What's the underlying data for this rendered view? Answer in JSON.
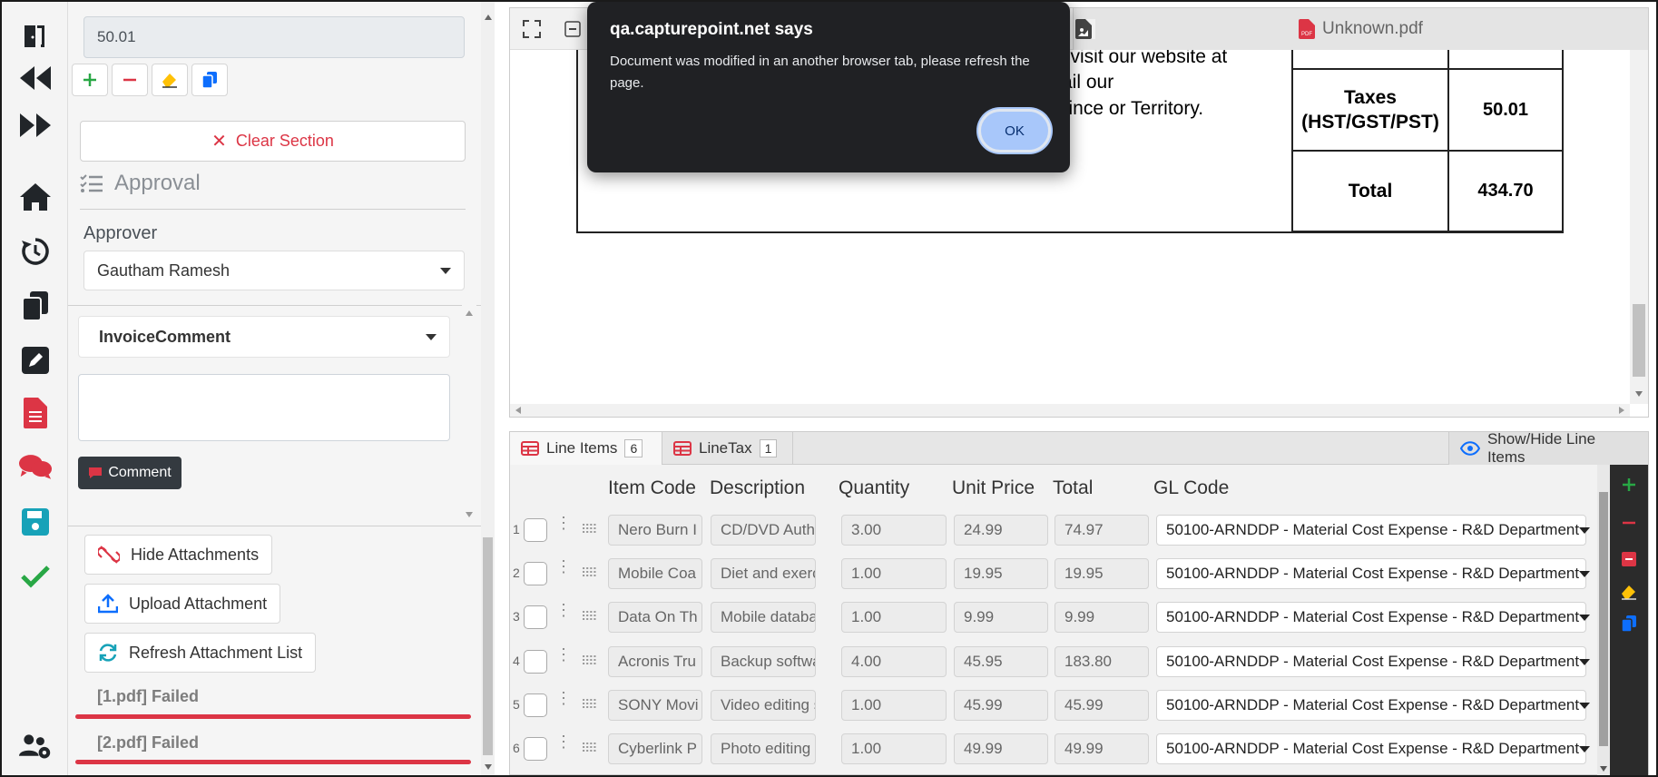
{
  "left": {
    "tax_value": "50.01",
    "clear_section_label": "Clear Section",
    "approval_title": "Approval",
    "approver_label": "Approver",
    "approver_value": "Gautham Ramesh",
    "comment_type": "InvoiceComment",
    "comment_value": "",
    "comment_button": "Comment",
    "hide_attachments": "Hide Attachments",
    "upload_attachment": "Upload Attachment",
    "refresh_attachments": "Refresh Attachment List",
    "attachments": [
      {
        "name": "[1.pdf] Failed"
      },
      {
        "name": "[2.pdf] Failed"
      }
    ]
  },
  "viewer": {
    "tab_label": "Unknown.pdf",
    "pdf_text_lines": [
      "e visit our website at",
      "ail our",
      "vince or Territory."
    ],
    "summary": {
      "taxes_label": "Taxes (HST/GST/PST)",
      "taxes_value": "50.01",
      "total_label": "Total",
      "total_value": "434.70"
    }
  },
  "dialog": {
    "title": "qa.capturepoint.net says",
    "message": "Document was modified in an another browser tab, please refresh the page.",
    "ok_label": "OK"
  },
  "line_items": {
    "tabs": [
      {
        "label": "Line Items",
        "count": "6"
      },
      {
        "label": "LineTax",
        "count": "1"
      }
    ],
    "show_hide_label": "Show/Hide Line Items",
    "columns": [
      "Item Code",
      "Description",
      "Quantity",
      "Unit Price",
      "Total",
      "GL Code"
    ],
    "rows": [
      {
        "num": "1",
        "item_code": "Nero Burn I",
        "description": "CD/DVD Autho",
        "quantity": "3.00",
        "unit_price": "24.99",
        "total": "74.97",
        "gl_code": "50100-ARNDDP - Material Cost Expense - R&D Department"
      },
      {
        "num": "2",
        "item_code": "Mobile Coa",
        "description": "Diet and exerci:",
        "quantity": "1.00",
        "unit_price": "19.95",
        "total": "19.95",
        "gl_code": "50100-ARNDDP - Material Cost Expense - R&D Department"
      },
      {
        "num": "3",
        "item_code": "Data On Th",
        "description": "Mobile databas",
        "quantity": "1.00",
        "unit_price": "9.99",
        "total": "9.99",
        "gl_code": "50100-ARNDDP - Material Cost Expense - R&D Department"
      },
      {
        "num": "4",
        "item_code": "Acronis Tru",
        "description": "Backup softwar",
        "quantity": "4.00",
        "unit_price": "45.95",
        "total": "183.80",
        "gl_code": "50100-ARNDDP - Material Cost Expense - R&D Department"
      },
      {
        "num": "5",
        "item_code": "SONY Movi",
        "description": "Video editing s",
        "quantity": "1.00",
        "unit_price": "45.99",
        "total": "45.99",
        "gl_code": "50100-ARNDDP - Material Cost Expense - R&D Department"
      },
      {
        "num": "6",
        "item_code": "Cyberlink P",
        "description": "Photo editing s",
        "quantity": "1.00",
        "unit_price": "49.99",
        "total": "49.99",
        "gl_code": "50100-ARNDDP - Material Cost Expense - R&D Department"
      }
    ]
  },
  "colors": {
    "accent_red": "#dc3545",
    "accent_green": "#28a745",
    "accent_blue": "#0d6efd",
    "dialog_bg": "#202124",
    "ok_button": "#a8c7fa"
  }
}
